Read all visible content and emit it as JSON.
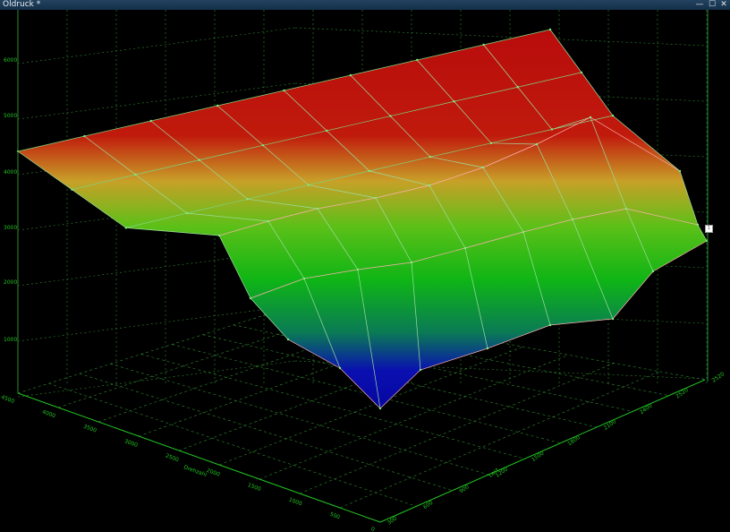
{
  "window": {
    "title": "Öldruck *",
    "minimize_glyph": "—",
    "maximize_glyph": "☐",
    "close_glyph": "✕"
  },
  "colors": {
    "grid": "#2f8a2f",
    "axis_text": "#22c322",
    "mesh_line": "#ffb0b0",
    "surface_high": "#b80c0c",
    "surface_mid": "#0fb515",
    "surface_low": "#0a0aa8"
  },
  "chart_data": {
    "type": "surface-3d",
    "z_ticks": [
      "1000",
      "2000",
      "3000",
      "4000",
      "5000",
      "6000"
    ],
    "x_ticks": [
      "4500",
      "4000",
      "3500",
      "3000",
      "2500",
      "2000",
      "1500",
      "1000",
      "500",
      "0"
    ],
    "y_ticks": [
      "2520",
      "2520",
      "2400",
      "2100",
      "1800",
      "1500",
      "1200",
      "900",
      "600",
      "300"
    ],
    "x_label": "Drehzahl",
    "y_label": "Last",
    "surface_z": [
      [
        4400,
        4700,
        5000,
        5300,
        5600,
        5900,
        6200,
        6400,
        6500
      ],
      [
        4300,
        4650,
        4950,
        5250,
        5550,
        5850,
        6150,
        6300,
        6400
      ],
      [
        4200,
        4600,
        4900,
        5200,
        5500,
        5800,
        6050,
        6200,
        6250
      ],
      [
        2500,
        2900,
        3300,
        3600,
        3900,
        4100,
        4250,
        4300,
        4300
      ],
      [
        1300,
        1700,
        2100,
        2400,
        2650,
        2900,
        3100,
        3300,
        3400
      ],
      [
        450,
        700,
        900,
        1100,
        1350,
        1600,
        2000,
        2500,
        2800
      ]
    ],
    "marker_label": "1"
  }
}
